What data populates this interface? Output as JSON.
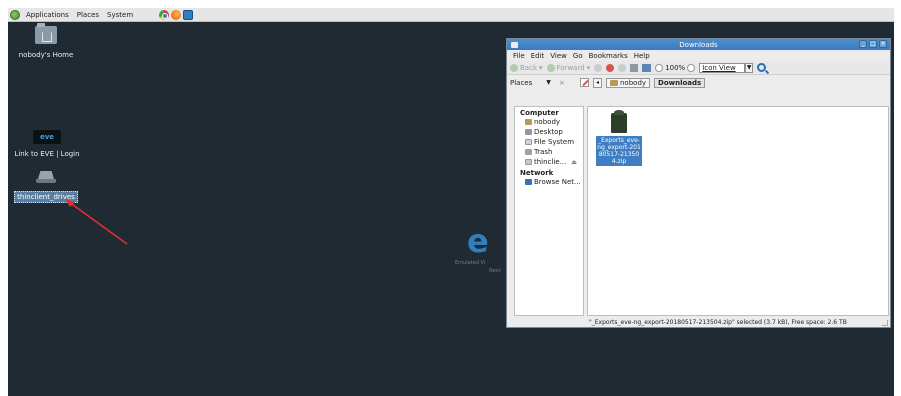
{
  "panel": {
    "menu": [
      "Applications",
      "Places",
      "System"
    ]
  },
  "desktop": {
    "icons": [
      {
        "label": "nobody's Home",
        "icon": "home-folder-icon"
      },
      {
        "label": "Link to EVE | Login",
        "icon": "eve-logo-icon",
        "glyph_text": "eve"
      },
      {
        "label": "thinclient_drives",
        "icon": "drive-icon"
      }
    ],
    "watermark": {
      "letter": "e",
      "line1": "Emulated Vi",
      "line2": "Next"
    }
  },
  "window": {
    "title": "Downloads",
    "menubar": [
      "File",
      "Edit",
      "View",
      "Go",
      "Bookmarks",
      "Help"
    ],
    "toolbar": {
      "back": "Back",
      "forward": "Forward",
      "zoom": "100%",
      "view": "Icon View"
    },
    "location": {
      "places_label": "Places",
      "close": "×",
      "crumbs": [
        "nobody",
        "Downloads"
      ]
    },
    "sidebar": {
      "computer_header": "Computer",
      "computer_items": [
        "nobody",
        "Desktop",
        "File System",
        "Trash",
        "thinclie..."
      ],
      "network_header": "Network",
      "network_items": [
        "Browse Net..."
      ]
    },
    "files": [
      {
        "name": "_Exports_eve-ng_export-20180517-213504.zip",
        "icon": "zip-archive-icon"
      }
    ],
    "status": "\"_Exports_eve-ng_export-20180517-213504.zip\" selected (3.7 kB), Free space: 2.6 TB"
  },
  "colors": {
    "desktop_bg": "#1f2a33",
    "titlebar": "#3b7bbd",
    "selection": "#3f7ec2",
    "arrow": "#e03030"
  }
}
